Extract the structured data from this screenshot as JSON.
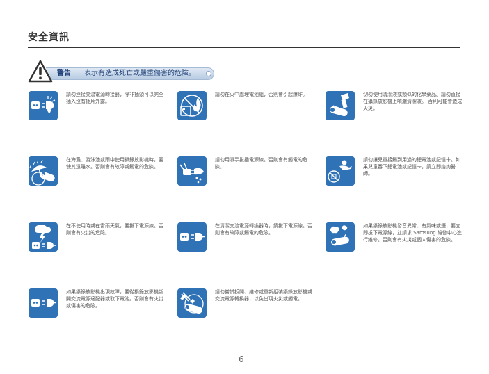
{
  "header": {
    "title": "安全資訊"
  },
  "warning": {
    "label": "警告",
    "text": "表示有造成死亡或嚴重傷害的危險。"
  },
  "items": [
    {
      "icon": "plug-no-bent-prongs-icon",
      "text": "請勿連接交流電源轉接器，除非插頭可以完全插入沒有插片外露。"
    },
    {
      "icon": "no-battery-in-fire-icon",
      "text": "請勿在火中處理電池組，否則會引起爆炸。"
    },
    {
      "icon": "no-chemical-spray-icon",
      "text": "切勿使用清潔液或類似的化學藥品。請勿直接在攝錄放影機上噴灑清潔液。 否則可能會造成火災。"
    },
    {
      "icon": "no-rain-water-icon",
      "text": "在海灘、游泳池或雨中使用攝錄放影機時，要使其遠離水。否則會有故障或觸電的危險。"
    },
    {
      "icon": "no-wet-hands-plug-icon",
      "text": "請勿用濕手拔插電源線。否則會有觸電的危險。"
    },
    {
      "icon": "child-swallow-battery-icon",
      "text": "請勿讓兒童接觸到用過的鋰電池或記憶卡。如果兒童吞下鋰電池或記憶卡，請立即諮詢醫師。"
    },
    {
      "icon": "lightning-unplug-icon",
      "text": "在不使用時或在雷雨天氣，要拔下電源線。否則會有火災的危險。"
    },
    {
      "icon": "unplug-before-cleaning-icon",
      "text": "在清潔交流電源轉換器時，請拔下電源線。否則會有故障或觸電的危險。"
    },
    {
      "icon": "smoke-smell-unplug-icon",
      "text": "如果攝錄放影機發音異常、有氣味或煙，要立即拔下電源線，並請求 Samsung 維修中心進行維修。否則會有火災或個人傷害的危險。"
    },
    {
      "icon": "malfunction-unplug-icon",
      "text": "如果攝錄放影機出現故障，要從攝錄放影機斷開交流電源適配器或取下電池。否則會有火災或傷害的危險。"
    },
    {
      "icon": "no-disassembly-icon",
      "text": "請勿嘗試拆開、維修或重新組裝攝錄放影機或交流電源轉換器，以免出現火災或觸電。"
    }
  ],
  "footer": {
    "page_number": "6"
  }
}
